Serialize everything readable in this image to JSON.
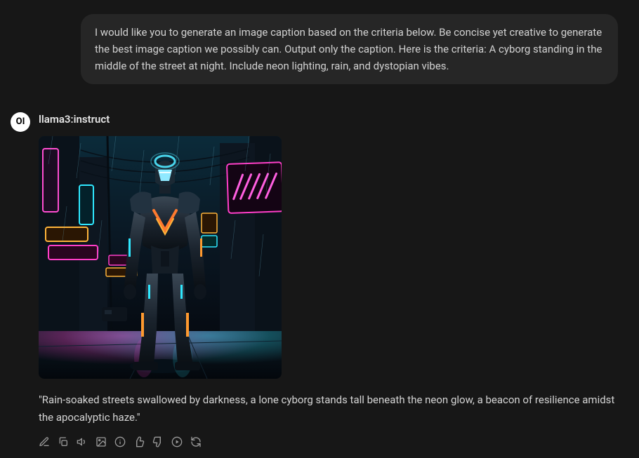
{
  "user_message": {
    "text": "I would like you to generate an image caption based on the criteria below. Be concise yet creative to generate the best image caption we possibly can. Output only the caption. Here is the criteria: A cyborg standing in the middle of the street at night. Include neon lighting, rain, and dystopian vibes."
  },
  "assistant": {
    "avatar_label": "OI",
    "model_name": "llama3:instruct",
    "image_alt": "cyborg-neon-street",
    "caption": "\"Rain-soaked streets swallowed by darkness, a lone cyborg stands tall beneath the neon glow, a beacon of resilience amidst the apocalyptic haze.\""
  },
  "actions": {
    "edit": "edit-icon",
    "copy": "copy-icon",
    "audio": "audio-icon",
    "image": "image-icon",
    "info": "info-icon",
    "thumbs_up": "thumbs-up-icon",
    "thumbs_down": "thumbs-down-icon",
    "continue": "continue-icon",
    "regenerate": "regenerate-icon"
  }
}
